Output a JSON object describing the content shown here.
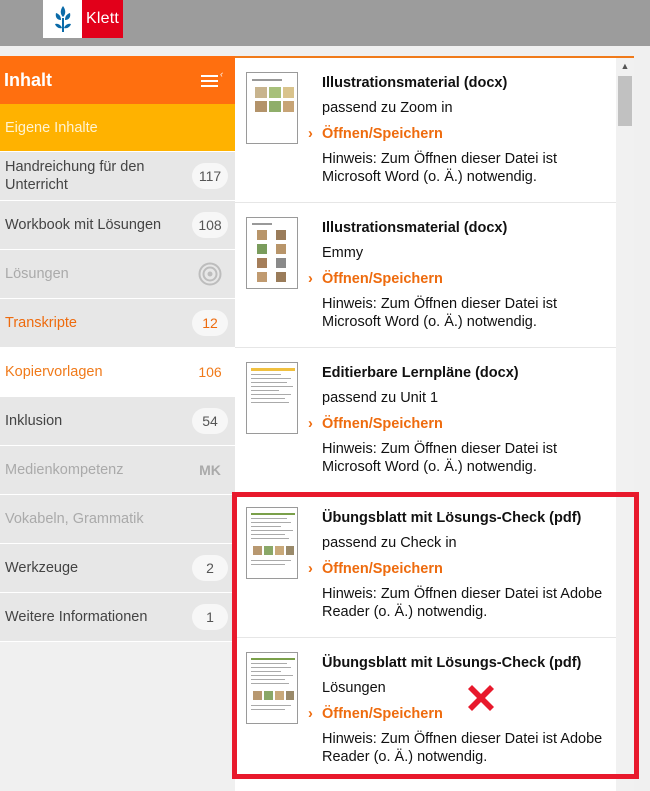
{
  "header": {
    "logo_text": "Klett"
  },
  "sidebar": {
    "title": "Inhalt",
    "items": [
      {
        "label": "Eigene Inhalte",
        "badge": ""
      },
      {
        "label": "Handreichung für den Unterricht",
        "badge": "117"
      },
      {
        "label": "Workbook mit Lösungen",
        "badge": "108"
      },
      {
        "label": "Lösungen",
        "badge": ""
      },
      {
        "label": "Transkripte",
        "badge": "12"
      },
      {
        "label": "Kopiervorlagen",
        "badge": "106"
      },
      {
        "label": "Inklusion",
        "badge": "54"
      },
      {
        "label": "Medienkompetenz",
        "badge": "MK"
      },
      {
        "label": "Vokabeln, Grammatik",
        "badge": ""
      },
      {
        "label": "Werkzeuge",
        "badge": "2"
      },
      {
        "label": "Weitere Informationen",
        "badge": "1"
      }
    ]
  },
  "entries": [
    {
      "title": "Illustrationsmaterial (docx)",
      "subtitle": "passend zu Zoom in",
      "open": "Öffnen/Speichern",
      "hint": "Hinweis: Zum Öffnen dieser Datei ist Microsoft Word (o. Ä.) notwendig."
    },
    {
      "title": "Illustrationsmaterial (docx)",
      "subtitle": "Emmy",
      "open": "Öffnen/Speichern",
      "hint": "Hinweis: Zum Öffnen dieser Datei ist Microsoft Word (o. Ä.) notwendig."
    },
    {
      "title": "Editierbare Lernpläne (docx)",
      "subtitle": "passend zu Unit 1",
      "open": "Öffnen/Speichern",
      "hint": "Hinweis: Zum Öffnen dieser Datei ist Microsoft Word (o. Ä.) notwendig."
    },
    {
      "title": "Übungsblatt mit Lösungs-Check (pdf)",
      "subtitle": "passend zu Check in",
      "open": "Öffnen/Speichern",
      "hint": "Hinweis: Zum Öffnen dieser Datei ist Adobe Reader (o. Ä.) notwendig."
    },
    {
      "title": "Übungsblatt mit Lösungs-Check (pdf)",
      "subtitle": "Lösungen",
      "open": "Öffnen/Speichern",
      "hint": "Hinweis: Zum Öffnen dieser Datei ist Adobe Reader (o. Ä.) notwendig."
    }
  ],
  "colors": {
    "accent": "#ff6f0f",
    "own_content": "#ffb200",
    "brand_red": "#e2001a",
    "highlight": "#e8192c"
  }
}
